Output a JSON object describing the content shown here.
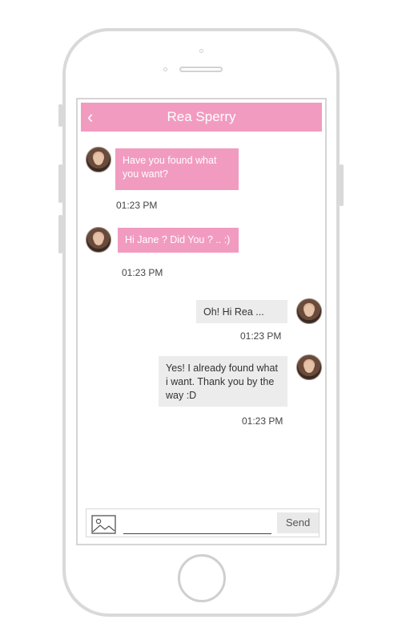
{
  "header": {
    "back_icon": "chevron-left-icon",
    "title": "Rea Sperry"
  },
  "messages": [
    {
      "direction": "incoming",
      "text": "Have you found what you want?",
      "time": "01:23 PM"
    },
    {
      "direction": "incoming",
      "text": "Hi Jane ? Did You ? .. :)",
      "time": "01:23 PM"
    },
    {
      "direction": "outgoing",
      "text": "Oh! Hi Rea ...",
      "time": "01:23 PM"
    },
    {
      "direction": "outgoing",
      "text": "Yes! I already found what i want. Thank you by the way :D",
      "time": "01:23 PM"
    }
  ],
  "composer": {
    "image_icon": "image-icon",
    "input_value": "",
    "input_placeholder": "",
    "send_label": "Send"
  },
  "colors": {
    "accent": "#f29bc1",
    "outgoing_bubble": "#ececec"
  }
}
